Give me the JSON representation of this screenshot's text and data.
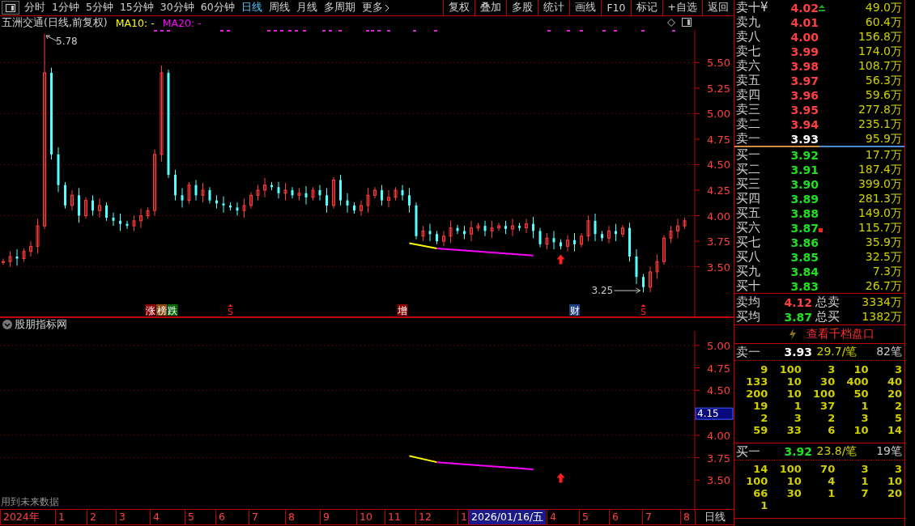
{
  "toolbar": {
    "periods": [
      {
        "label": "分时",
        "selected": false
      },
      {
        "label": "1分钟",
        "selected": false
      },
      {
        "label": "5分钟",
        "selected": false
      },
      {
        "label": "15分钟",
        "selected": false
      },
      {
        "label": "30分钟",
        "selected": false
      },
      {
        "label": "60分钟",
        "selected": false
      },
      {
        "label": "日线",
        "selected": true
      },
      {
        "label": "周线",
        "selected": false
      },
      {
        "label": "月线",
        "selected": false
      },
      {
        "label": "多周期",
        "selected": false
      }
    ],
    "more": "更多",
    "buttons": [
      "复权",
      "叠加",
      "多股",
      "统计",
      "画线",
      "F10",
      "标记",
      "+自选",
      "返回"
    ]
  },
  "title_bar": {
    "stock": "五洲交通(日线,前复权)",
    "ma10": "MA10: -",
    "ma20": "MA20: -"
  },
  "price_chart": {
    "y_axis": [
      "5.50",
      "5.25",
      "5.00",
      "4.75",
      "4.50",
      "4.25",
      "4.00",
      "3.75",
      "3.50"
    ],
    "high_label": "5.78",
    "low_label": "3.25",
    "markers": [
      {
        "kind": "tag",
        "text": "涨",
        "color": "#8b0000"
      },
      {
        "kind": "tag",
        "text": "榜",
        "color": "#8b4a10"
      },
      {
        "kind": "tag",
        "text": "跌",
        "color": "#0a6a0a"
      },
      {
        "kind": "signal",
        "text": "S"
      },
      {
        "kind": "tag",
        "text": "增",
        "color": "#8b0000"
      },
      {
        "kind": "tag",
        "text": "财",
        "color": "#1f3f7f"
      },
      {
        "kind": "signal",
        "text": "S"
      }
    ]
  },
  "indicator_panel": {
    "title": "股朋指标网",
    "note": "用到未来数据",
    "y_axis": [
      "5.00",
      "4.75",
      "4.50",
      "4.00",
      "3.75",
      "3.50"
    ],
    "readout": "4.15"
  },
  "time_axis": {
    "labels": [
      {
        "label": "2024年",
        "highlighted": false
      },
      {
        "label": "1",
        "highlighted": false
      },
      {
        "label": "2",
        "highlighted": false
      },
      {
        "label": "3",
        "highlighted": false
      },
      {
        "label": "4",
        "highlighted": false
      },
      {
        "label": "5",
        "highlighted": false
      },
      {
        "label": "6",
        "highlighted": false
      },
      {
        "label": "7",
        "highlighted": false
      },
      {
        "label": "8",
        "highlighted": false
      },
      {
        "label": "9",
        "highlighted": false
      },
      {
        "label": "10",
        "highlighted": false
      },
      {
        "label": "11",
        "highlighted": false
      },
      {
        "label": "12",
        "highlighted": false
      },
      {
        "label": "1",
        "highlighted": false
      },
      {
        "label": "2026/01/16/五",
        "highlighted": true
      },
      {
        "label": "4",
        "highlighted": false
      },
      {
        "label": "5",
        "highlighted": false
      },
      {
        "label": "6",
        "highlighted": false
      },
      {
        "label": "7",
        "highlighted": false
      },
      {
        "label": "8",
        "highlighted": false
      }
    ],
    "period": "日线"
  },
  "order_book": {
    "asks": [
      {
        "label": "卖十¥",
        "price": "4.02",
        "color": "#ff4040",
        "volume": "49.0万",
        "kind": "arrow"
      },
      {
        "label": "卖九",
        "price": "4.01",
        "color": "#ff4040",
        "volume": "60.4万",
        "kind": "plain"
      },
      {
        "label": "卖八",
        "price": "4.00",
        "color": "#ff4040",
        "volume": "156.8万",
        "kind": "plain"
      },
      {
        "label": "卖七",
        "price": "3.99",
        "color": "#ff4040",
        "volume": "174.0万",
        "kind": "plain"
      },
      {
        "label": "卖六",
        "price": "3.98",
        "color": "#ff4040",
        "volume": "108.7万",
        "kind": "plain"
      },
      {
        "label": "卖五",
        "price": "3.97",
        "color": "#ff4040",
        "volume": "56.3万",
        "kind": "plain"
      },
      {
        "label": "卖四",
        "price": "3.96",
        "color": "#ff4040",
        "volume": "59.6万",
        "kind": "plain"
      },
      {
        "label": "卖三",
        "price": "3.95",
        "color": "#ff4040",
        "volume": "277.8万",
        "kind": "plain"
      },
      {
        "label": "卖二",
        "price": "3.94",
        "color": "#ff4040",
        "volume": "235.1万",
        "kind": "plain"
      },
      {
        "label": "卖一",
        "price": "3.93",
        "color": "#ffffff",
        "volume": "95.9万",
        "kind": "plain"
      }
    ],
    "ratio_bar": {
      "level": 0.5
    },
    "bids": [
      {
        "label": "买一",
        "price": "3.92",
        "color": "#20e020",
        "volume": "17.7万",
        "kind": "plain"
      },
      {
        "label": "买二",
        "price": "3.91",
        "color": "#20e020",
        "volume": "187.4万",
        "kind": "plain"
      },
      {
        "label": "买三",
        "price": "3.90",
        "color": "#20e020",
        "volume": "399.0万",
        "kind": "plain"
      },
      {
        "label": "买四",
        "price": "3.89",
        "color": "#20e020",
        "volume": "281.3万",
        "kind": "plain"
      },
      {
        "label": "买五",
        "price": "3.88",
        "color": "#20e020",
        "volume": "149.0万",
        "kind": "plain"
      },
      {
        "label": "买六",
        "price": "3.87",
        "color": "#20e020",
        "volume": "115.7万",
        "kind": "dot"
      },
      {
        "label": "买七",
        "price": "3.86",
        "color": "#20e020",
        "volume": "35.9万",
        "kind": "plain"
      },
      {
        "label": "买八",
        "price": "3.85",
        "color": "#20e020",
        "volume": "32.5万",
        "kind": "plain"
      },
      {
        "label": "买九",
        "price": "3.84",
        "color": "#20e020",
        "volume": "7.3万",
        "kind": "plain"
      },
      {
        "label": "买十",
        "price": "3.83",
        "color": "#20e020",
        "volume": "26.7万",
        "kind": "plain"
      }
    ],
    "averages": [
      {
        "label": "卖均",
        "price": "4.12",
        "color": "#ff4040",
        "total_label": "总卖",
        "total": "3334万"
      },
      {
        "label": "买均",
        "price": "3.87",
        "color": "#20e020",
        "total_label": "总买",
        "total": "1382万"
      }
    ],
    "link": "查看千档盘口"
  },
  "tick_sections": [
    {
      "label": "卖一",
      "price": "3.93",
      "color": "#ffffff",
      "per_trade": "29.7/笔",
      "count": "82笔",
      "rows": [
        [
          "9",
          "100",
          "3",
          "10",
          "3"
        ],
        [
          "133",
          "10",
          "30",
          "400",
          "40"
        ],
        [
          "200",
          "10",
          "100",
          "50",
          "20"
        ],
        [
          "19",
          "1",
          "37",
          "1",
          "2"
        ],
        [
          "2",
          "3",
          "2",
          "3",
          "5"
        ],
        [
          "59",
          "33",
          "6",
          "10",
          "14"
        ]
      ]
    },
    {
      "label": "买一",
      "price": "3.92",
      "color": "#20e020",
      "per_trade": "23.8/笔",
      "count": "19笔",
      "rows": [
        [
          "14",
          "100",
          "70",
          "3",
          "3"
        ],
        [
          "100",
          "10",
          "4",
          "1",
          "10"
        ],
        [
          "66",
          "30",
          "1",
          "7",
          "20"
        ],
        [
          "1"
        ]
      ]
    }
  ]
}
